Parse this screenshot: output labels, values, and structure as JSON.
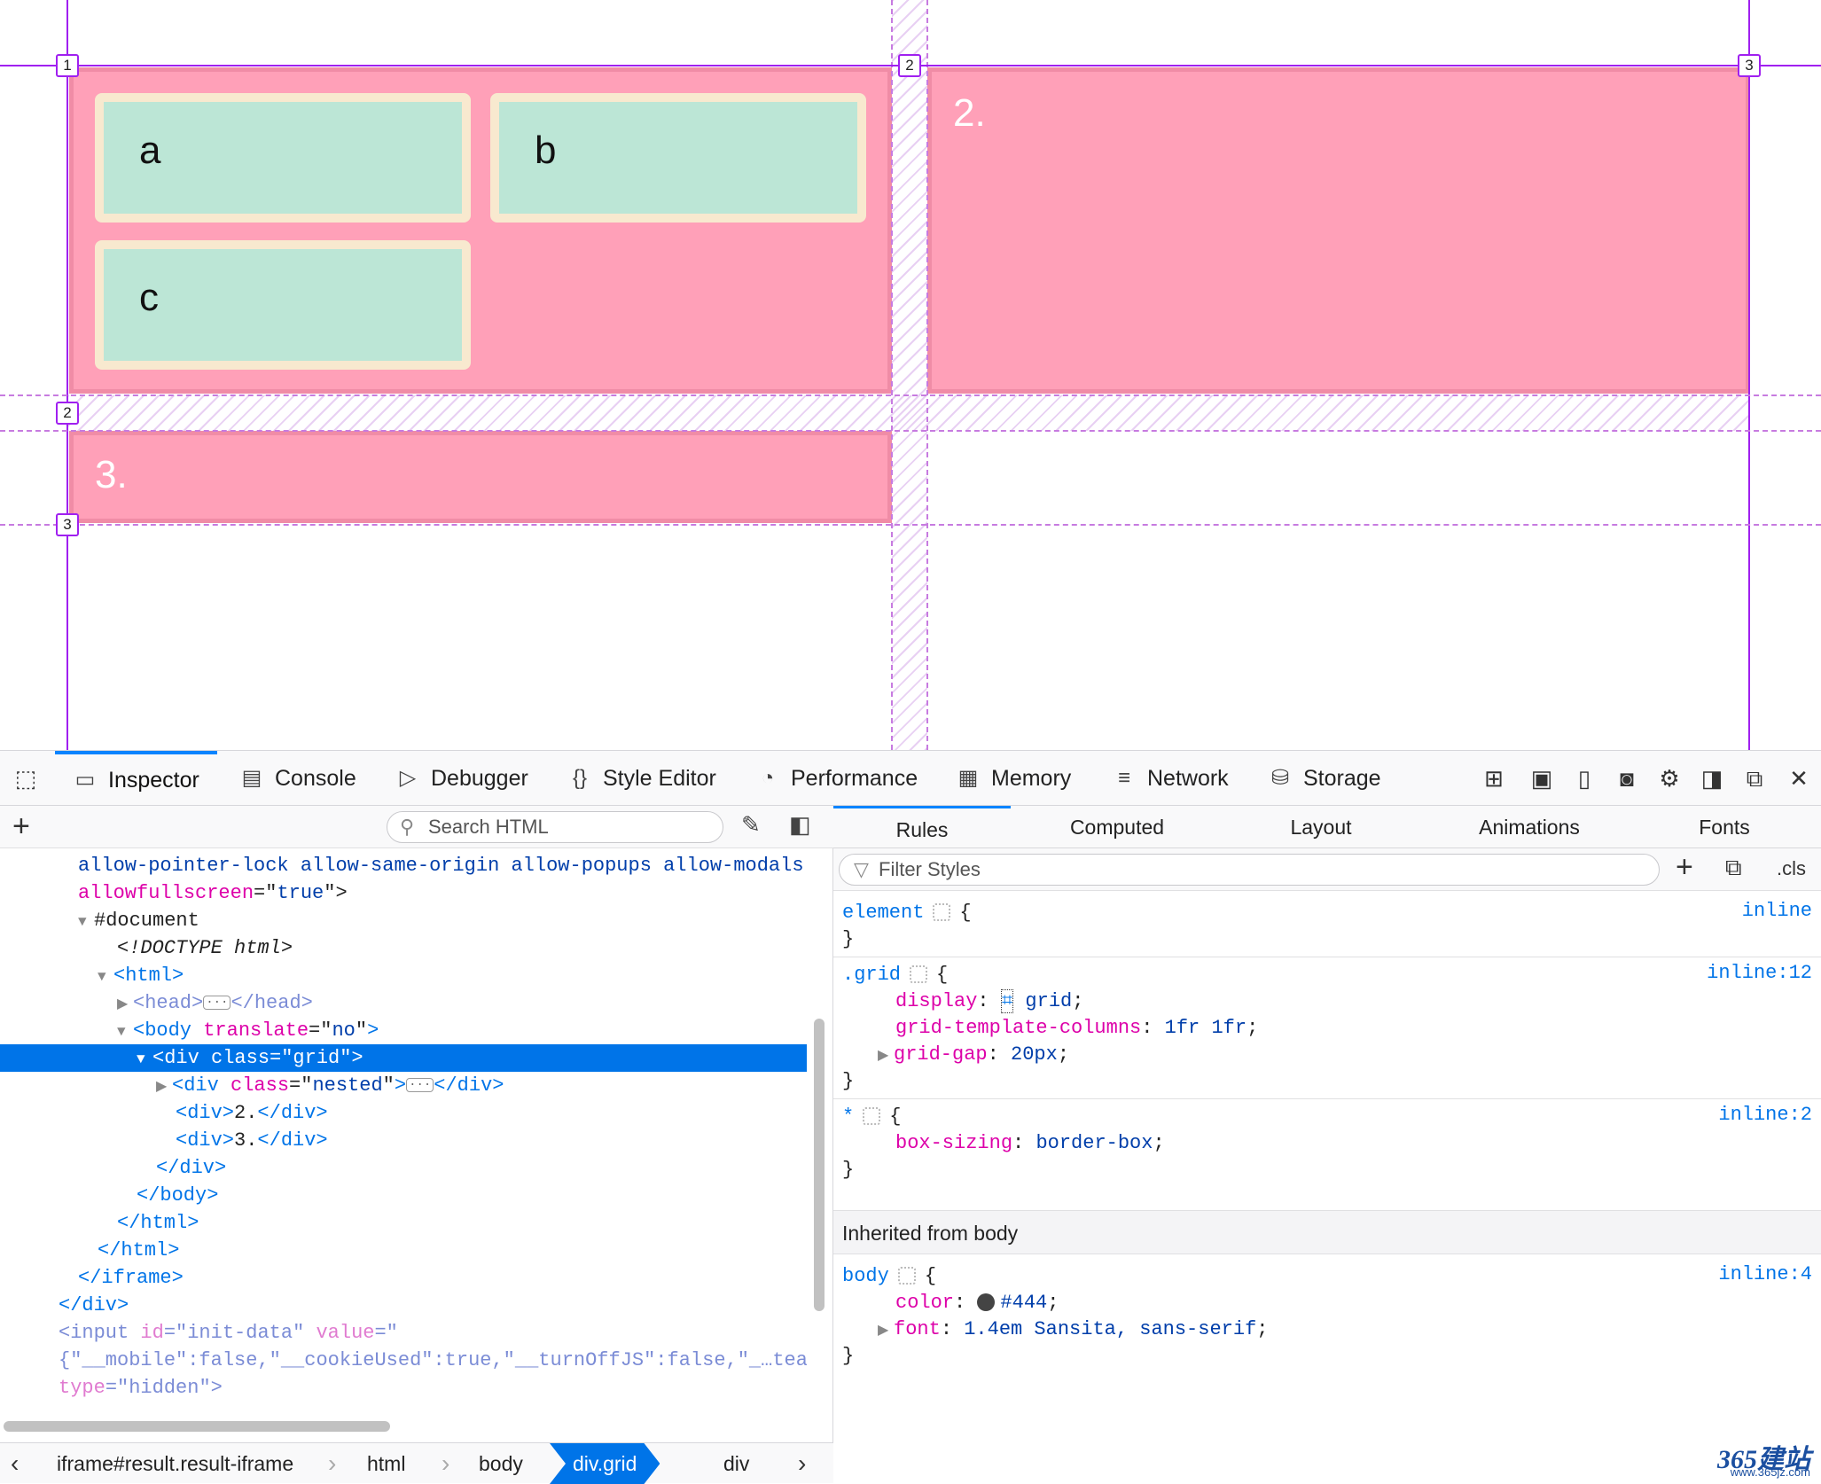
{
  "preview": {
    "cells": {
      "a": "a",
      "b": "b",
      "c": "c",
      "two": "2.",
      "three": "3."
    },
    "grid_badges": {
      "col": [
        "1",
        "2",
        "3"
      ],
      "row": [
        "2",
        "3"
      ]
    }
  },
  "toolbar": {
    "tabs": [
      {
        "label": "Inspector",
        "icon": "inspector-icon"
      },
      {
        "label": "Console",
        "icon": "console-icon"
      },
      {
        "label": "Debugger",
        "icon": "debugger-icon"
      },
      {
        "label": "Style Editor",
        "icon": "style-editor-icon"
      },
      {
        "label": "Performance",
        "icon": "performance-icon"
      },
      {
        "label": "Memory",
        "icon": "memory-icon"
      },
      {
        "label": "Network",
        "icon": "network-icon"
      },
      {
        "label": "Storage",
        "icon": "storage-icon"
      }
    ],
    "active_tab": "Inspector"
  },
  "markup": {
    "search_placeholder": "Search HTML",
    "lines": [
      {
        "a": "allow-pointer-lock allow-same-origin allow-popups allow-modals"
      },
      {
        "attr": "allowfullscreen",
        "eq": "=\"",
        "val": "true",
        "end": "\">"
      },
      {
        "txt": "#document"
      },
      {
        "txt": "<!DOCTYPE html>"
      },
      {
        "tag": "<html>"
      },
      {
        "tag1": "<head>",
        "tag2": "</head>"
      },
      {
        "tag": "<body",
        "attr": "translate",
        "val": "no",
        "end": ">"
      },
      {
        "tag": "<div class=\"grid\">"
      },
      {
        "tag": "<div",
        "attr": "class",
        "val": "nested",
        "end": ">",
        "close": "</div>"
      },
      {
        "tag": "<div>",
        "txt": "2.",
        "close": "</div>"
      },
      {
        "tag": "<div>",
        "txt": "3.",
        "close": "</div>"
      },
      {
        "tag": "</div>"
      },
      {
        "tag": "</body>"
      },
      {
        "tag": "</html>"
      },
      {
        "tag": "</html>"
      },
      {
        "tag": "</iframe>"
      },
      {
        "tag": "</div>"
      },
      {
        "tag": "<input",
        "attr": "id",
        "val": "init-data",
        "attr2": "value",
        "eq2": "=\""
      },
      {
        "txt": "{\"__mobile\":false,\"__cookieUsed\":true,\"__turnOffJS\":false,\"_…tea"
      },
      {
        "attr": "type",
        "val": "hidden",
        "end": "\">"
      }
    ]
  },
  "breadcrumbs": [
    "iframe#result.result-iframe",
    "html",
    "body",
    "div.grid",
    "div"
  ],
  "rules": {
    "tabs": [
      "Rules",
      "Computed",
      "Layout",
      "Animations",
      "Fonts"
    ],
    "filter_placeholder": "Filter Styles",
    "cls_label": ".cls",
    "blocks": [
      {
        "selector": "element",
        "source": "inline",
        "decls": []
      },
      {
        "selector": ".grid",
        "source": "inline:12",
        "decls": [
          {
            "prop": "display",
            "value": "grid"
          },
          {
            "prop": "grid-template-columns",
            "value": "1fr 1fr"
          },
          {
            "prop": "grid-gap",
            "value": "20px"
          }
        ]
      },
      {
        "selector": "*",
        "source": "inline:2",
        "decls": [
          {
            "prop": "box-sizing",
            "value": "border-box"
          }
        ]
      }
    ],
    "inherited_label": "Inherited from body",
    "body_block": {
      "selector": "body",
      "source": "inline:4",
      "decls": [
        {
          "prop": "color",
          "value": "#444"
        },
        {
          "prop": "font",
          "value": "1.4em Sansita, sans-serif"
        }
      ]
    }
  },
  "watermark": {
    "brand": "365建站",
    "url": "www.365jz.com"
  },
  "colors": {
    "accent": "#0a84ff",
    "grid_overlay": "#a020f0",
    "cell": "#ffa0b8",
    "inner": "#bce6d6"
  }
}
